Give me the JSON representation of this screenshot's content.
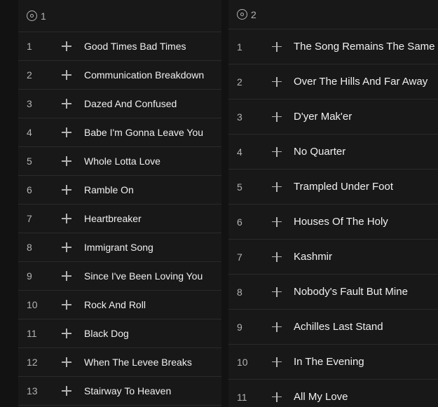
{
  "discs": [
    {
      "disc_number": "1",
      "tracks": [
        {
          "number": "1",
          "title": "Good Times Bad Times"
        },
        {
          "number": "2",
          "title": "Communication Breakdown"
        },
        {
          "number": "3",
          "title": "Dazed And Confused"
        },
        {
          "number": "4",
          "title": "Babe I'm Gonna Leave You"
        },
        {
          "number": "5",
          "title": "Whole Lotta Love"
        },
        {
          "number": "6",
          "title": "Ramble On"
        },
        {
          "number": "7",
          "title": "Heartbreaker"
        },
        {
          "number": "8",
          "title": "Immigrant Song"
        },
        {
          "number": "9",
          "title": "Since I've Been Loving You"
        },
        {
          "number": "10",
          "title": "Rock And Roll"
        },
        {
          "number": "11",
          "title": "Black Dog"
        },
        {
          "number": "12",
          "title": "When The Levee Breaks"
        },
        {
          "number": "13",
          "title": "Stairway To Heaven"
        }
      ]
    },
    {
      "disc_number": "2",
      "tracks": [
        {
          "number": "1",
          "title": "The Song Remains The Same"
        },
        {
          "number": "2",
          "title": "Over The Hills And Far Away"
        },
        {
          "number": "3",
          "title": "D'yer Mak'er"
        },
        {
          "number": "4",
          "title": "No Quarter"
        },
        {
          "number": "5",
          "title": "Trampled Under Foot"
        },
        {
          "number": "6",
          "title": "Houses Of The Holy"
        },
        {
          "number": "7",
          "title": "Kashmir"
        },
        {
          "number": "8",
          "title": "Nobody's Fault But Mine"
        },
        {
          "number": "9",
          "title": "Achilles Last Stand"
        },
        {
          "number": "10",
          "title": "In The Evening"
        },
        {
          "number": "11",
          "title": "All My Love"
        }
      ]
    }
  ],
  "icons": {
    "disc": "disc-icon",
    "add": "plus-icon"
  },
  "colors": {
    "background": "#121212",
    "panel": "#181818",
    "text": "#f0f0f0",
    "muted": "#b3b3b3",
    "divider": "#2a2a2a"
  }
}
